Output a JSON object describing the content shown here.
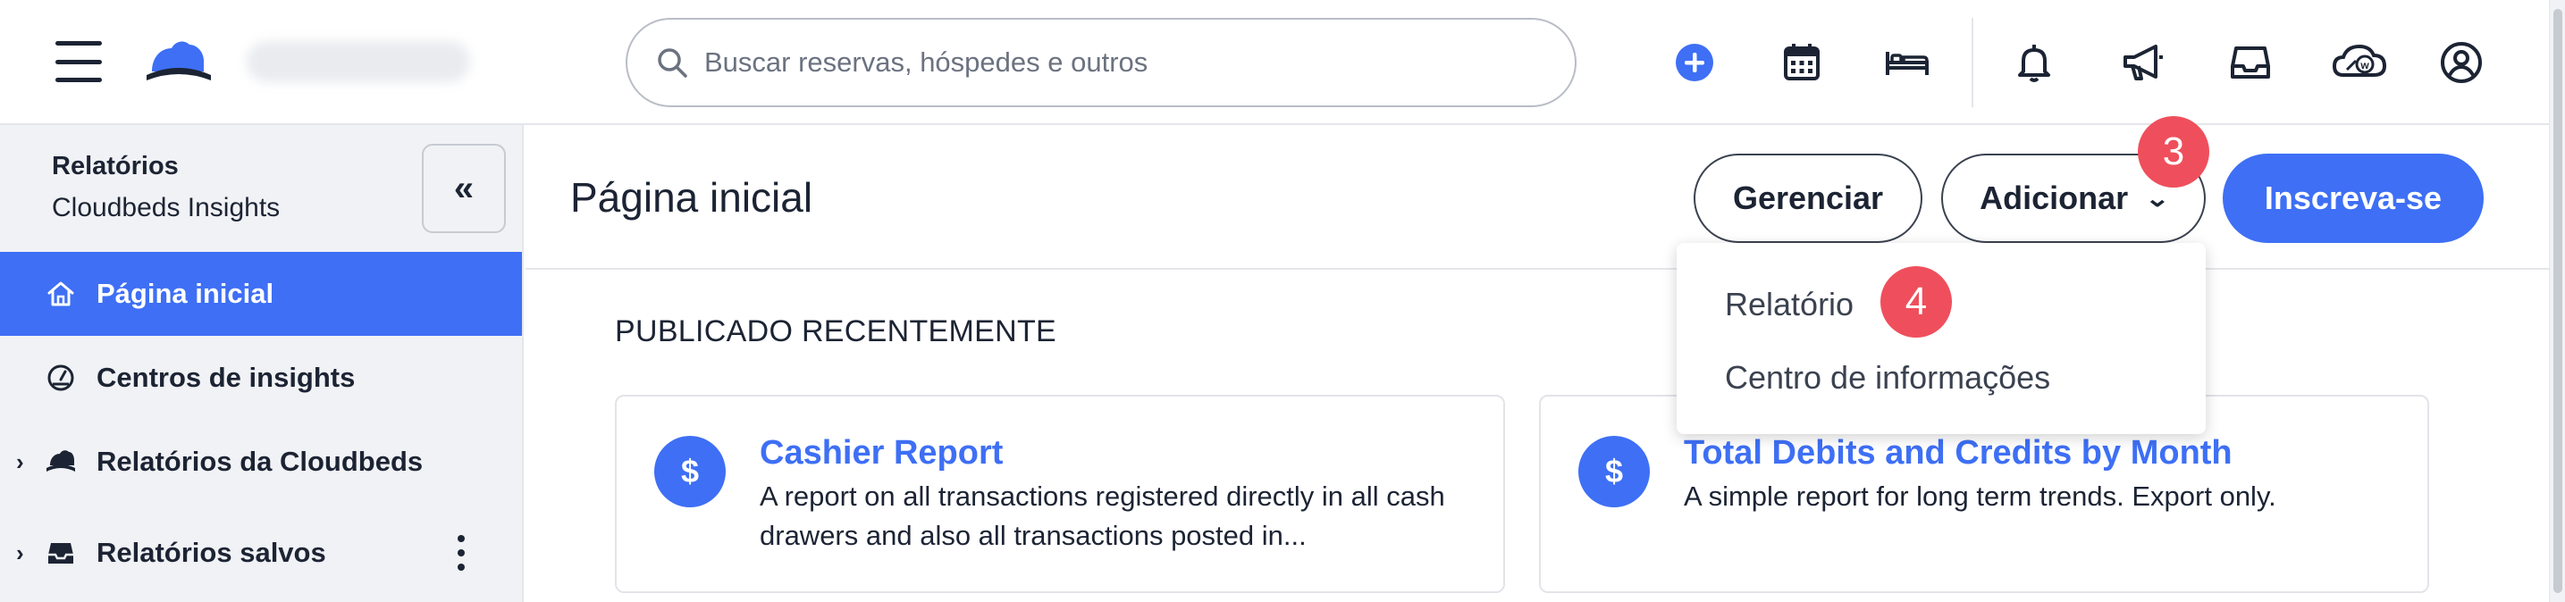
{
  "topbar": {
    "search_placeholder": "Buscar reservas, hóspedes e outros",
    "icons": [
      "menu-icon",
      "cloudbeds-logo",
      "add-icon",
      "calendar-icon",
      "bed-icon",
      "bell-icon",
      "megaphone-icon",
      "inbox-icon",
      "whistle-cloud-icon",
      "user-icon"
    ],
    "accent": "#3e6ff5"
  },
  "sidebar": {
    "title": "Relatórios",
    "subtitle": "Cloudbeds Insights",
    "collapse_label": "«",
    "items": [
      {
        "label": "Página inicial",
        "icon": "home-icon",
        "active": true
      },
      {
        "label": "Centros de insights",
        "icon": "gauge-icon",
        "active": false
      },
      {
        "label": "Relatórios da Cloudbeds",
        "icon": "cloudbeds-icon",
        "active": false,
        "expandable": true
      },
      {
        "label": "Relatórios salvos",
        "icon": "inbox-icon",
        "active": false,
        "expandable": true
      }
    ]
  },
  "main": {
    "title": "Página inicial",
    "manage_label": "Gerenciar",
    "add_label": "Adicionar",
    "subscribe_label": "Inscreva-se",
    "section_title": "PUBLICADO RECENTEMENTE",
    "cards": [
      {
        "title": "Cashier Report",
        "description": "A report on all transactions registered directly in all cash drawers and also all transactions posted in..."
      },
      {
        "title": "Total Debits and Credits by Month",
        "description": "A simple report for long term trends. Export only."
      }
    ]
  },
  "dropdown": {
    "items": [
      "Relatório",
      "Centro de informações"
    ]
  },
  "badges": {
    "add_step": "3",
    "report_step": "4",
    "color": "#ef4f5c"
  }
}
